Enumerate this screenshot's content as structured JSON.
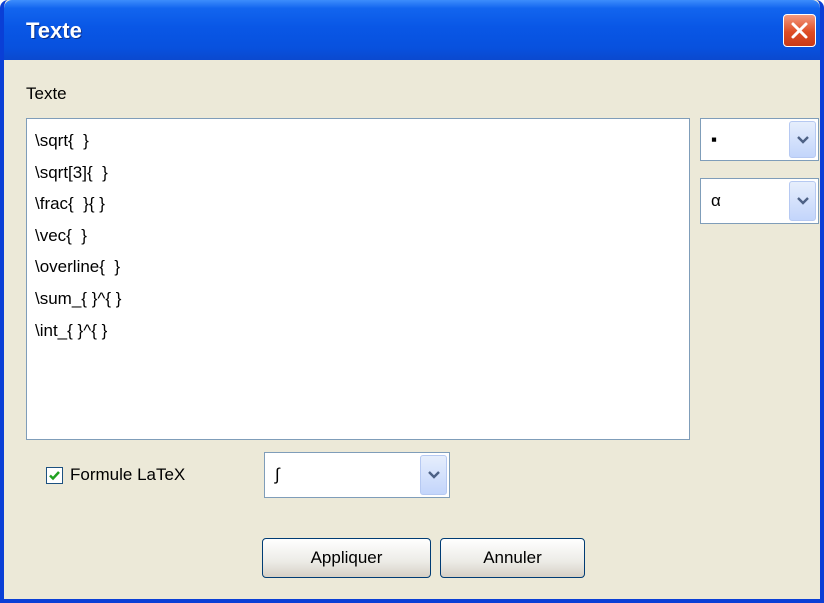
{
  "window": {
    "title": "Texte"
  },
  "form": {
    "text_label": "Texte",
    "text_lines": [
      "\\sqrt{  }",
      "\\sqrt[3]{  }",
      "\\frac{  }{ }",
      "\\vec{  }",
      "\\overline{  }",
      "\\sum_{ }^{ }",
      "\\int_{ }^{ }"
    ],
    "symbol_combo_1": "▪",
    "symbol_combo_2": "α",
    "latex_checkbox": {
      "label": "Formule LaTeX",
      "checked": true
    },
    "latex_combo": "∫"
  },
  "buttons": {
    "apply": "Appliquer",
    "cancel": "Annuler"
  },
  "colors": {
    "titlebar": "#0957e6",
    "close": "#de4d25",
    "face": "#ece9d8",
    "field_border": "#7f9db9"
  }
}
